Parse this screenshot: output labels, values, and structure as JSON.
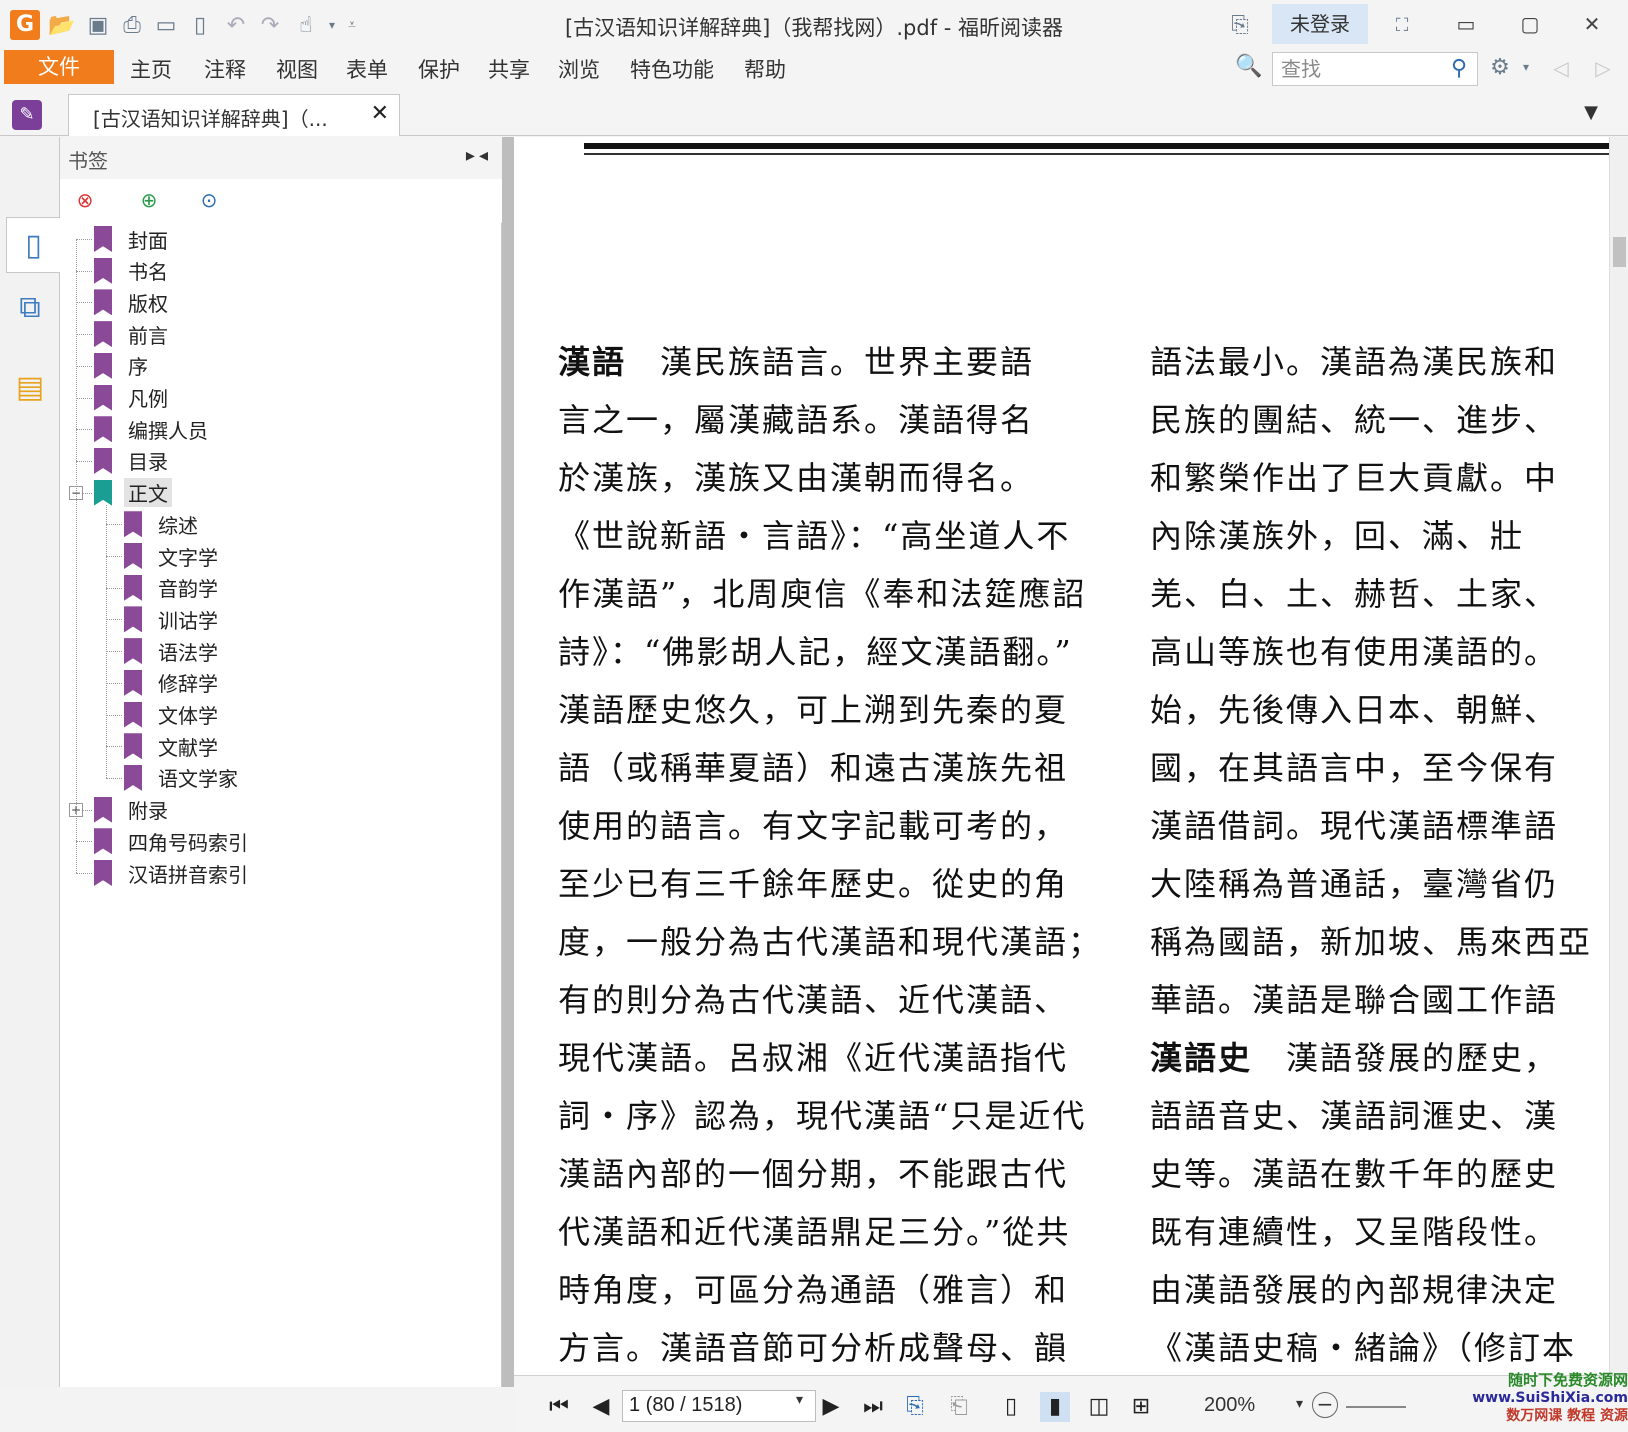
{
  "window": {
    "title": "[古汉语知识详解辞典]（我帮找网）.pdf - 福昕阅读器",
    "login_label": "未登录"
  },
  "menu": {
    "file_label": "文件",
    "items": [
      "主页",
      "注释",
      "视图",
      "表单",
      "保护",
      "共享",
      "浏览",
      "特色功能",
      "帮助"
    ]
  },
  "search": {
    "placeholder": "查找"
  },
  "tab": {
    "title": "[古汉语知识详解辞典]（...",
    "close": "✕"
  },
  "bookmarks": {
    "panel_title": "书签",
    "items": [
      {
        "label": "封面",
        "level": 0
      },
      {
        "label": "书名",
        "level": 0
      },
      {
        "label": "版权",
        "level": 0
      },
      {
        "label": "前言",
        "level": 0
      },
      {
        "label": "序",
        "level": 0
      },
      {
        "label": "凡例",
        "level": 0
      },
      {
        "label": "编撰人员",
        "level": 0
      },
      {
        "label": "目录",
        "level": 0
      },
      {
        "label": "正文",
        "level": 0,
        "expanded": true,
        "selected": true
      },
      {
        "label": "综述",
        "level": 1
      },
      {
        "label": "文字学",
        "level": 1
      },
      {
        "label": "音韵学",
        "level": 1
      },
      {
        "label": "训诂学",
        "level": 1
      },
      {
        "label": "语法学",
        "level": 1
      },
      {
        "label": "修辞学",
        "level": 1
      },
      {
        "label": "文体学",
        "level": 1
      },
      {
        "label": "文献学",
        "level": 1
      },
      {
        "label": "语文学家",
        "level": 1
      },
      {
        "label": "附录",
        "level": 0,
        "expanded": false
      },
      {
        "label": "四角号码索引",
        "level": 0
      },
      {
        "label": "汉语拼音索引",
        "level": 0
      }
    ]
  },
  "document": {
    "left_column": [
      {
        "head": "漢語",
        "text": "　漢民族語言。世界主要語"
      },
      {
        "text": "言之一，屬漢藏語系。漢語得名"
      },
      {
        "text": "於漢族，漢族又由漢朝而得名。"
      },
      {
        "text": "《世說新語・言語》：“高坐道人不"
      },
      {
        "text": "作漢語”，北周庾信《奉和法筵應詔"
      },
      {
        "text": "詩》：“佛影胡人記，經文漢語翻。”"
      },
      {
        "text": "漢語歷史悠久，可上溯到先秦的夏"
      },
      {
        "text": "語（或稱華夏語）和遠古漢族先祖"
      },
      {
        "text": "使用的語言。有文字記載可考的，"
      },
      {
        "text": "至少已有三千餘年歷史。從史的角"
      },
      {
        "text": "度，一般分為古代漢語和現代漢語；"
      },
      {
        "text": "有的則分為古代漢語、近代漢語、"
      },
      {
        "text": "現代漢語。呂叔湘《近代漢語指代"
      },
      {
        "text": "詞・序》認為，現代漢語“只是近代"
      },
      {
        "text": "漢語內部的一個分期，不能跟古代"
      },
      {
        "text": "代漢語和近代漢語鼎足三分。”從共"
      },
      {
        "text": "時角度，可區分為通語（雅言）和"
      },
      {
        "text": "方言。漢語音節可分析成聲母、韻"
      }
    ],
    "right_column": [
      {
        "text": "語法最小。漢語為漢民族和"
      },
      {
        "text": "民族的團結、統一、進步、"
      },
      {
        "text": "和繁榮作出了巨大貢獻。中"
      },
      {
        "text": "內除漢族外，回、滿、壯"
      },
      {
        "text": "羌、白、土、赫哲、土家、"
      },
      {
        "text": "高山等族也有使用漢語的。"
      },
      {
        "text": "始，先後傳入日本、朝鮮、"
      },
      {
        "text": "國，在其語言中，至今保有"
      },
      {
        "text": "漢語借詞。現代漢語標準語"
      },
      {
        "text": "大陸稱為普通話，臺灣省仍"
      },
      {
        "text": "稱為國語，新加坡、馬來西亞"
      },
      {
        "text": "華語。漢語是聯合國工作語"
      },
      {
        "head": "漢語史",
        "text": "　漢語發展的歷史，"
      },
      {
        "text": "語語音史、漢語詞滙史、漢"
      },
      {
        "text": "史等。漢語在數千年的歷史"
      },
      {
        "text": "既有連續性，又呈階段性。"
      },
      {
        "text": "由漢語發展的內部規律決定"
      },
      {
        "text": "《漢語史稿・緒論》（修訂本"
      }
    ]
  },
  "status": {
    "page_field": "1 (80 / 1518)",
    "zoom": "200%"
  },
  "watermark": {
    "line1": "随时下免费资源网",
    "line2": "www.SuiShiXia.com",
    "line3": "数万网课 教程 资源"
  }
}
